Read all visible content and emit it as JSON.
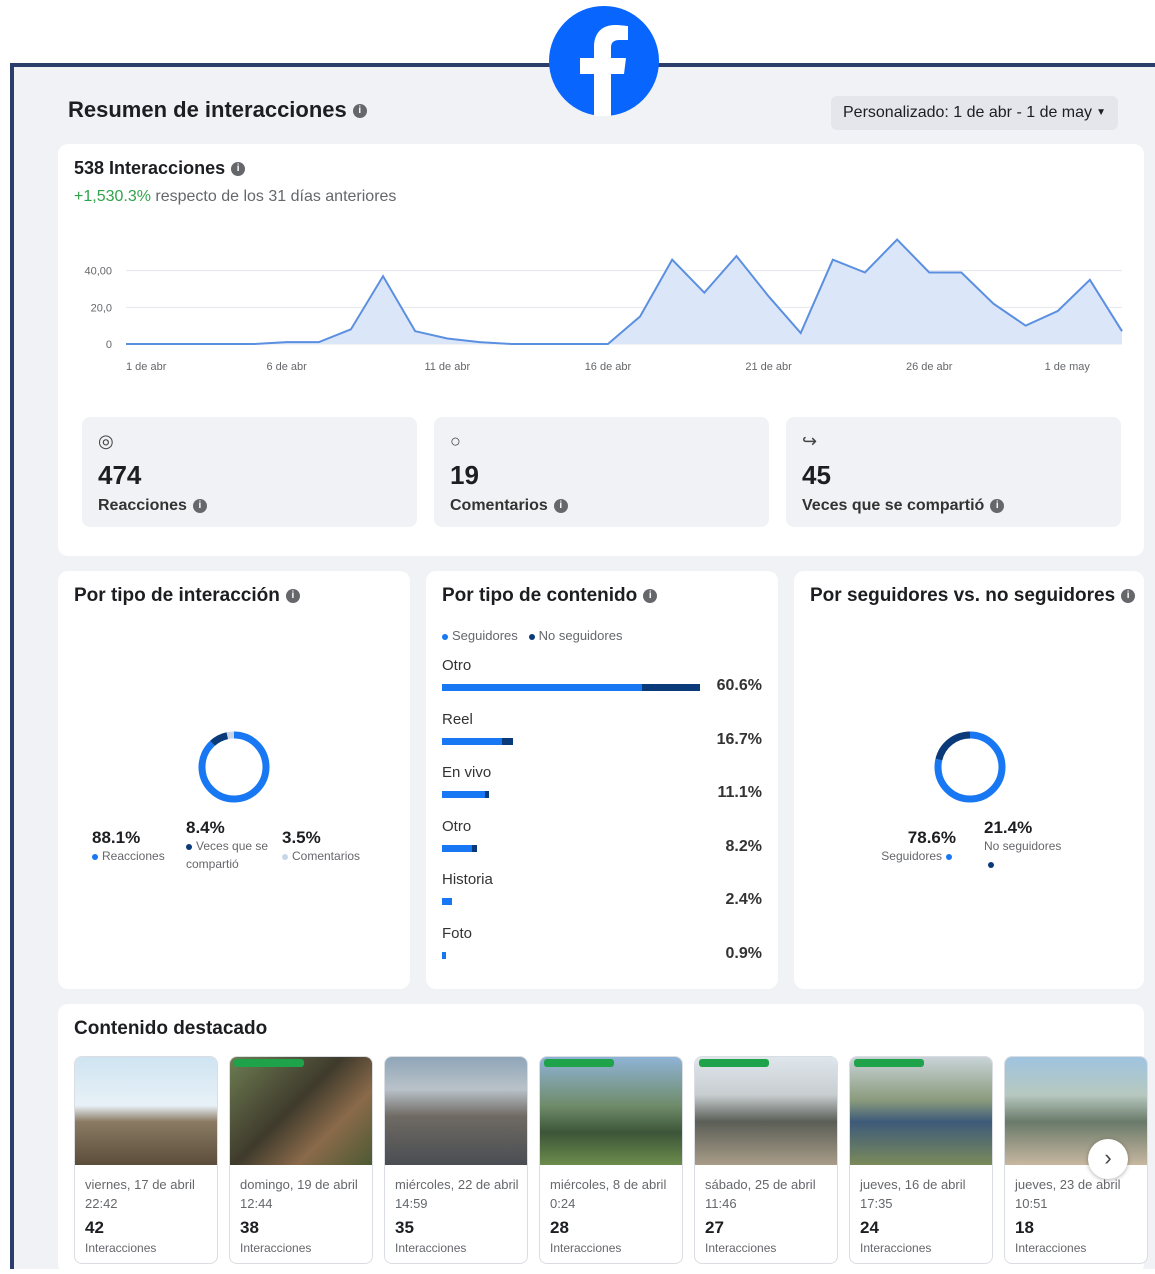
{
  "header": {
    "title": "Resumen de interacciones",
    "date_range": "Personalizado: 1 de abr - 1 de may"
  },
  "summary": {
    "total_label": "538 Interacciones",
    "change_value": "+1,530.3%",
    "change_text": " respecto de los 31 días anteriores"
  },
  "chart_data": {
    "type": "area",
    "y_ticks": [
      "40,00",
      "20,0",
      "0"
    ],
    "x_ticks": [
      "1 de abr",
      "6 de abr",
      "11 de abr",
      "16 de abr",
      "21 de abr",
      "26 de abr",
      "1 de may"
    ],
    "ylim": [
      0,
      60
    ],
    "series": [
      {
        "values": [
          0,
          0,
          0,
          0,
          0,
          1,
          1,
          8,
          37,
          7,
          3,
          1,
          0,
          0,
          0,
          0,
          15,
          46,
          28,
          48,
          26,
          6,
          46,
          39,
          57,
          39,
          39,
          22,
          10,
          18,
          35,
          7
        ]
      }
    ],
    "color": "#5b8fe0"
  },
  "stats": [
    {
      "icon": "reactions-icon",
      "glyph": "◎",
      "value": "474",
      "label": "Reacciones"
    },
    {
      "icon": "comment-icon",
      "glyph": "○",
      "value": "19",
      "label": "Comentarios"
    },
    {
      "icon": "share-icon",
      "glyph": "↪",
      "value": "45",
      "label": "Veces que se compartió"
    }
  ],
  "by_interaction": {
    "title": "Por tipo de interacción",
    "items": [
      {
        "pct": "88.1%",
        "label": "Reacciones",
        "value": 88.1,
        "color": "#1877f2"
      },
      {
        "pct": "8.4%",
        "label": "Veces que se compartió",
        "value": 8.4,
        "color": "#0a3a7a"
      },
      {
        "pct": "3.5%",
        "label": "Comentarios",
        "value": 3.5,
        "color": "#c9d6ea"
      }
    ]
  },
  "by_content": {
    "title": "Por tipo de contenido",
    "legend": [
      "Seguidores",
      "No seguidores"
    ],
    "colors": [
      "#1877f2",
      "#0a3a7a"
    ],
    "rows": [
      {
        "name": "Otro",
        "pct": "60.6%",
        "followers": 47,
        "non_followers": 13.6
      },
      {
        "name": "Reel",
        "pct": "16.7%",
        "followers": 14,
        "non_followers": 2.7
      },
      {
        "name": "En vivo",
        "pct": "11.1%",
        "followers": 10,
        "non_followers": 1.1
      },
      {
        "name": "Otro",
        "pct": "8.2%",
        "followers": 7,
        "non_followers": 1.2
      },
      {
        "name": "Historia",
        "pct": "2.4%",
        "followers": 2.4,
        "non_followers": 0
      },
      {
        "name": "Foto",
        "pct": "0.9%",
        "followers": 0.9,
        "non_followers": 0
      }
    ]
  },
  "by_followers": {
    "title": "Por seguidores vs. no seguidores",
    "items": [
      {
        "pct": "78.6%",
        "label": "Seguidores",
        "value": 78.6,
        "color": "#1877f2"
      },
      {
        "pct": "21.4%",
        "label": "No seguidores",
        "value": 21.4,
        "color": "#0a3a7a"
      }
    ]
  },
  "featured": {
    "title": "Contenido destacado",
    "count_label": "Interacciones",
    "posts": [
      {
        "date": "viernes, 17 de abril 22:42",
        "count": "42",
        "bg": "linear-gradient(#cfe4f2 0%,#e8f1f7 45%,#8a7a63 60%,#5b4d3b 100%)",
        "badge": false
      },
      {
        "date": "domingo, 19 de abril 12:44",
        "count": "38",
        "bg": "linear-gradient(135deg,#6d7d52 0%,#3f3a2c 45%,#8a6a4a 70%,#4d5a34 100%)",
        "badge": true
      },
      {
        "date": "miércoles, 22 de abril 14:59",
        "count": "35",
        "bg": "linear-gradient(#8fa6b8 0%,#b9c2c9 30%,#6f6a63 55%,#4a4d52 100%)",
        "badge": false
      },
      {
        "date": "miércoles, 8 de abril 0:24",
        "count": "28",
        "bg": "linear-gradient(#8fb3d6 0%,#6f8c6a 45%,#3c5538 70%,#6c8c4c 100%)",
        "badge": true
      },
      {
        "date": "sábado, 25 de abril 11:46",
        "count": "27",
        "bg": "linear-gradient(#dfe6ec 0%,#c8cdd0 35%,#5b5e57 60%,#a89c88 100%)",
        "badge": true
      },
      {
        "date": "jueves, 16 de abril 17:35",
        "count": "24",
        "bg": "linear-gradient(#c9d3d8 0%,#8a9b7c 40%,#3d5a7a 60%,#7a8a5a 100%)",
        "badge": true
      },
      {
        "date": "jueves, 23 de abril 10:51",
        "count": "18",
        "bg": "linear-gradient(#9fc3e0 0%,#b7c9c0 35%,#6a7a6a 60%,#c7b7a0 100%)",
        "badge": false
      }
    ]
  }
}
